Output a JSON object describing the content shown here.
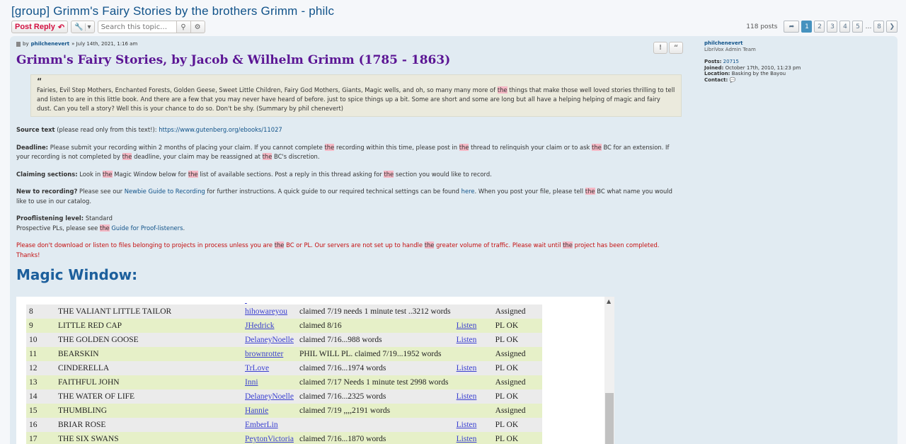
{
  "topic": {
    "title": "[group] Grimm's Fairy Stories by the brothers Grimm - philc"
  },
  "action_bar": {
    "post_reply": "Post Reply",
    "search_placeholder": "Search this topic…"
  },
  "pagination": {
    "posts_count": "118 posts",
    "pages": [
      "1",
      "2",
      "3",
      "4",
      "5"
    ],
    "ellipsis": "…",
    "last_page": "8",
    "active_page": "1"
  },
  "post": {
    "meta_by": "by",
    "author": "philchenevert",
    "date": "» July 14th, 2021, 1:16 am",
    "title": "Grimm's Fairy Stories, by Jacob & Wilhelm Grimm (1785 - 1863)",
    "quote_before": "Fairies, Evil Step Mothers, Enchanted Forests, Golden Geese, Sweet Little Children, Fairy God Mothers, Giants, Magic wells, and oh, so many many more of",
    "quote_hl": "the",
    "quote_after": "things that make those well loved stories thrilling to tell and listen to are in this little book. And there are a few that you may never have heard of before. just to spice things up a bit. Some are short and some are long but all have a helping helping of magic and fairy dust. Can you tell a story? Well this is your chance to do so. Don't be shy. (Summary by phil chenevert)",
    "hl": "the",
    "source": {
      "label": "Source text",
      "note": "(please read only from this text!):",
      "link": "https://www.gutenberg.org/ebooks/11027"
    },
    "deadline": {
      "label": "Deadline:",
      "t1": "Please submit your recording within 2 months of placing your claim. If you cannot complete",
      "t2": "recording within this time, please post in",
      "t3": "thread to relinquish your claim or to ask",
      "t4": "BC for an extension. If your recording is not completed by",
      "t5": "deadline, your claim may be reassigned at",
      "t6": "BC's discretion."
    },
    "claiming": {
      "label": "Claiming sections:",
      "t1": "Look in",
      "t2": "Magic Window below for",
      "t3": "list of available sections. Post a reply in this thread asking for",
      "t4": "section you would like to record."
    },
    "new_recording": {
      "label": "New to recording?",
      "t1": "Please see our",
      "link1": "Newbie Guide to Recording",
      "t2": "for further instructions. A quick guide to our required technical settings can be found",
      "link2": "here",
      "t3": ". When you post your file, please tell",
      "t4": "BC what name you would like to use in our catalog."
    },
    "prooflistening": {
      "label": "Prooflistening level:",
      "level": "Standard",
      "t1": "Prospective PLs, please see",
      "link": "Guide for Proof-listeners",
      "t2": "."
    },
    "warning": {
      "t1": "Please don't download or listen to files belonging to projects in process unless you are",
      "t2": "BC or PL. Our servers are not set up to handle",
      "t3": "greater volume of traffic. Please wait until",
      "t4": "project has been completed. Thanks!"
    },
    "magic_window_heading": "Magic Window:"
  },
  "magic_table": {
    "rows": [
      {
        "num": "8",
        "title": "THE VALIANT LITTLE TAILOR",
        "reader": "hihowareyou",
        "note": "claimed 7/19 needs 1 minute test ..3212 words",
        "listen": "",
        "status": "Assigned"
      },
      {
        "num": "9",
        "title": "LITTLE RED CAP",
        "reader": "JHedrick",
        "note": "claimed 8/16",
        "listen": "Listen",
        "status": "PL OK"
      },
      {
        "num": "10",
        "title": "THE GOLDEN GOOSE",
        "reader": "DelaneyNoelle",
        "note": "claimed 7/16...988 words",
        "listen": "Listen",
        "status": "PL OK"
      },
      {
        "num": "11",
        "title": "BEARSKIN",
        "reader": "brownrotter",
        "note": "PHIL WILL PL. claimed 7/19...1952 words",
        "listen": "",
        "status": "Assigned"
      },
      {
        "num": "12",
        "title": "CINDERELLA",
        "reader": "TrLove",
        "note": "claimed 7/16...1974 words",
        "listen": "Listen",
        "status": "PL OK"
      },
      {
        "num": "13",
        "title": "FAITHFUL JOHN",
        "reader": "Inni",
        "note": "claimed 7/17 Needs 1 minute test 2998 words",
        "listen": "",
        "status": "Assigned"
      },
      {
        "num": "14",
        "title": "THE WATER OF LIFE",
        "reader": "DelaneyNoelle",
        "note": "claimed 7/16...2325 words",
        "listen": "Listen",
        "status": "PL OK"
      },
      {
        "num": "15",
        "title": "THUMBLING",
        "reader": "Hannie",
        "note": "claimed 7/19 ,,,,2191 words",
        "listen": "",
        "status": "Assigned"
      },
      {
        "num": "16",
        "title": "BRIAR ROSE",
        "reader": "EmberLin",
        "note": "",
        "listen": "Listen",
        "status": "PL OK"
      },
      {
        "num": "17",
        "title": "THE SIX SWANS",
        "reader": "PeytonVictoria",
        "note": "claimed 7/16...1870 words",
        "listen": "Listen",
        "status": "PL OK"
      }
    ]
  },
  "profile": {
    "username": "philchenevert",
    "rank": "LibriVox Admin Team",
    "posts_label": "Posts:",
    "posts": "20715",
    "joined_label": "Joined:",
    "joined": "October 17th, 2010, 11:23 pm",
    "location_label": "Location:",
    "location": "Basking by the Bayou",
    "contact_label": "Contact:"
  }
}
